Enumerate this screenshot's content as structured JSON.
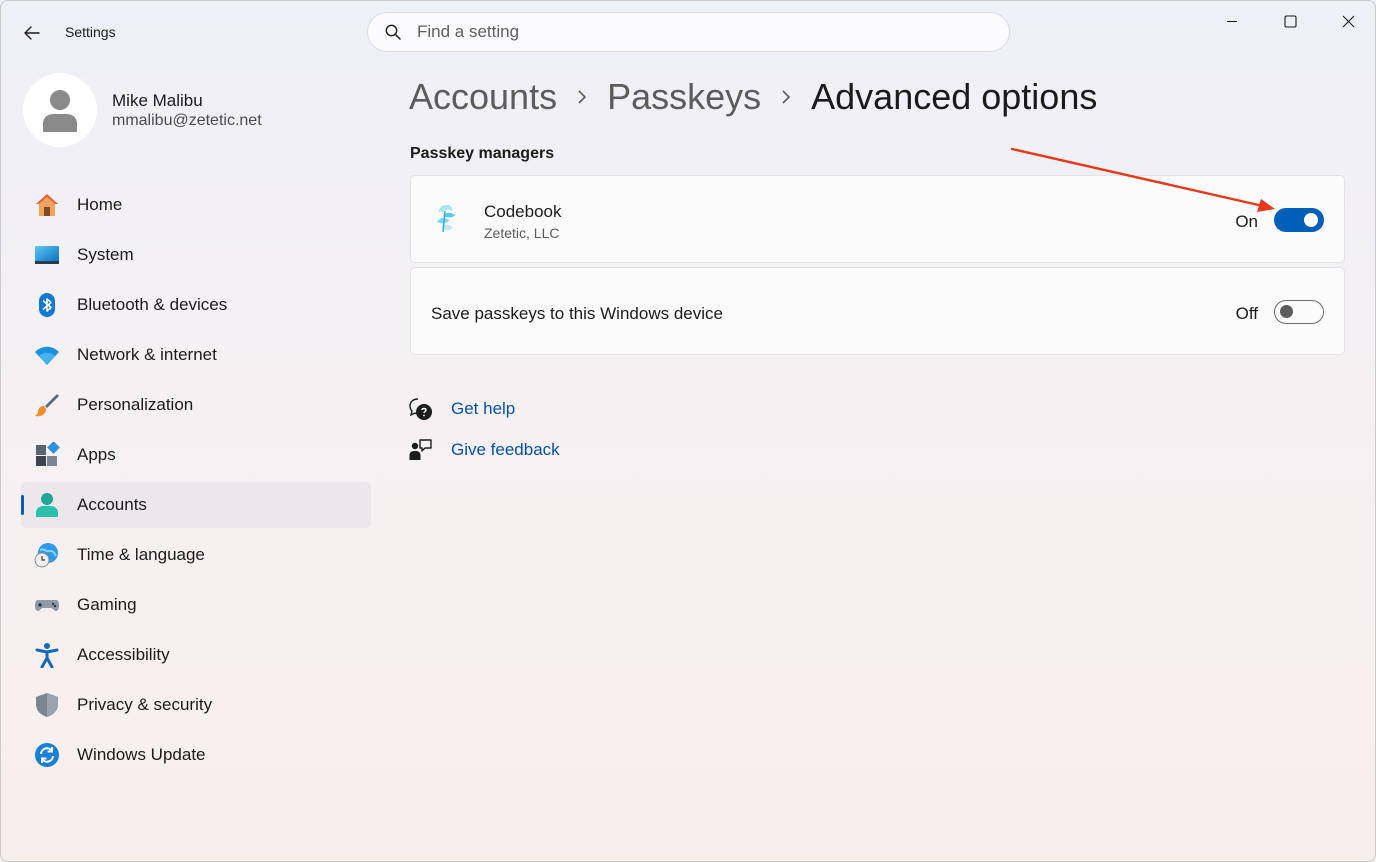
{
  "window": {
    "title": "Settings"
  },
  "search": {
    "placeholder": "Find a setting"
  },
  "profile": {
    "name": "Mike Malibu",
    "email": "mmalibu@zetetic.net"
  },
  "sidebar": {
    "items": [
      {
        "label": "Home",
        "icon": "home-icon"
      },
      {
        "label": "System",
        "icon": "system-icon"
      },
      {
        "label": "Bluetooth & devices",
        "icon": "bluetooth-icon"
      },
      {
        "label": "Network & internet",
        "icon": "wifi-icon"
      },
      {
        "label": "Personalization",
        "icon": "brush-icon"
      },
      {
        "label": "Apps",
        "icon": "apps-icon"
      },
      {
        "label": "Accounts",
        "icon": "accounts-icon",
        "active": true
      },
      {
        "label": "Time & language",
        "icon": "clock-globe-icon"
      },
      {
        "label": "Gaming",
        "icon": "gamepad-icon"
      },
      {
        "label": "Accessibility",
        "icon": "accessibility-icon"
      },
      {
        "label": "Privacy & security",
        "icon": "shield-icon"
      },
      {
        "label": "Windows Update",
        "icon": "update-icon"
      }
    ]
  },
  "breadcrumb": {
    "items": [
      "Accounts",
      "Passkeys"
    ],
    "current": "Advanced options"
  },
  "section": {
    "title": "Passkey managers"
  },
  "managers": [
    {
      "name": "Codebook",
      "publisher": "Zetetic, LLC",
      "state": "On",
      "enabled": true,
      "icon": "codebook-icon"
    }
  ],
  "windows_device": {
    "label": "Save passkeys to this Windows device",
    "state": "Off",
    "enabled": false
  },
  "help": {
    "get_help": "Get help",
    "give_feedback": "Give feedback"
  },
  "colors": {
    "accent": "#005fb8",
    "annotation_arrow": "#e8381b",
    "link": "#0a4fa3"
  }
}
